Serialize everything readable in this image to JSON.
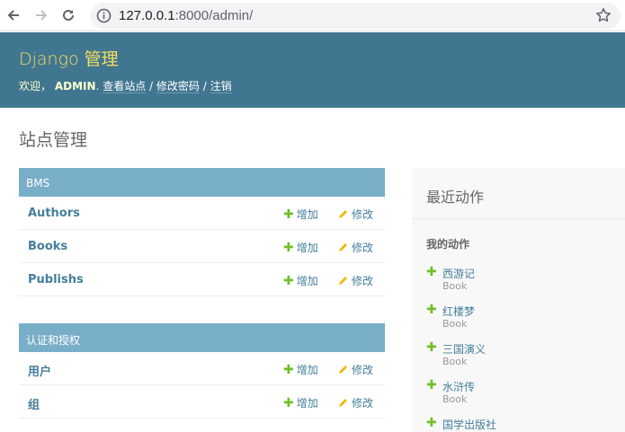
{
  "browser": {
    "url_host": "127.0.0.1",
    "url_rest": ":8000/admin/"
  },
  "header": {
    "branding": "Django 管理",
    "welcome": "欢迎，",
    "username": "ADMIN",
    "period": ".",
    "view_site": "查看站点",
    "sep1": "/",
    "change_password": "修改密码",
    "sep2": "/",
    "logout": "注销"
  },
  "page_title": "站点管理",
  "modules": [
    {
      "caption": "BMS",
      "models": [
        {
          "name": "Authors",
          "add": "增加",
          "change": "修改"
        },
        {
          "name": "Books",
          "add": "增加",
          "change": "修改"
        },
        {
          "name": "Publishs",
          "add": "增加",
          "change": "修改"
        }
      ]
    },
    {
      "caption": "认证和授权",
      "models": [
        {
          "name": "用户",
          "add": "增加",
          "change": "修改"
        },
        {
          "name": "组",
          "add": "增加",
          "change": "修改"
        }
      ]
    }
  ],
  "recent_actions": {
    "title": "最近动作",
    "subtitle": "我的动作",
    "items": [
      {
        "name": "西游记",
        "type": "Book"
      },
      {
        "name": "红楼梦",
        "type": "Book"
      },
      {
        "name": "三国演义",
        "type": "Book"
      },
      {
        "name": "水浒传",
        "type": "Book"
      },
      {
        "name": "国学出版社",
        "type": ""
      }
    ]
  },
  "colors": {
    "header_bg": "#417690",
    "branding": "#f5dd5d",
    "caption_bg": "#79aec8",
    "link": "#447e9b",
    "add_icon": "#70bf2b",
    "change_icon": "#efb80b"
  }
}
